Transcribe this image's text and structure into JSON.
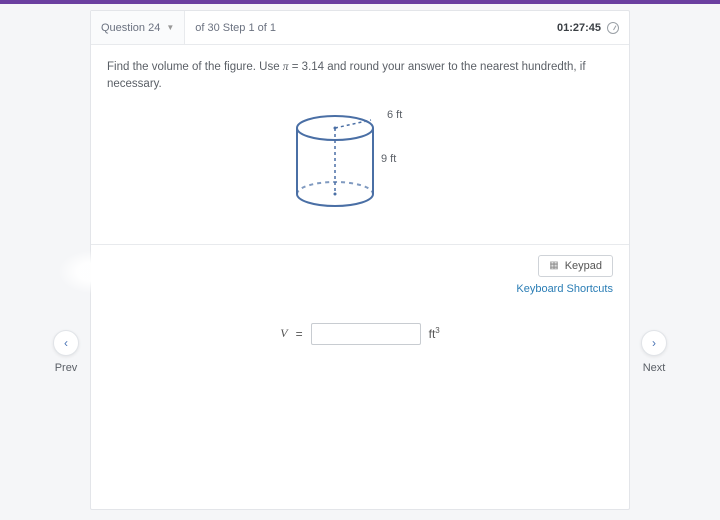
{
  "header": {
    "question_label": "Question 24",
    "step_label": "of 30 Step 1 of 1",
    "timer": "01:27:45"
  },
  "prompt": {
    "pre": "Find the volume of the figure. Use ",
    "pi": "π",
    "eq": " = ",
    "piv": "3.14",
    "post": " and round your answer to the nearest hundredth, if necessary."
  },
  "figure": {
    "radius_label": "6 ft",
    "height_label": "9 ft"
  },
  "tools": {
    "keypad": "Keypad",
    "shortcuts": "Keyboard Shortcuts"
  },
  "answer": {
    "lhs": "V",
    "equals": "=",
    "unit_base": "ft",
    "unit_exp": "3",
    "value": ""
  },
  "nav": {
    "prev": "Prev",
    "next": "Next"
  }
}
